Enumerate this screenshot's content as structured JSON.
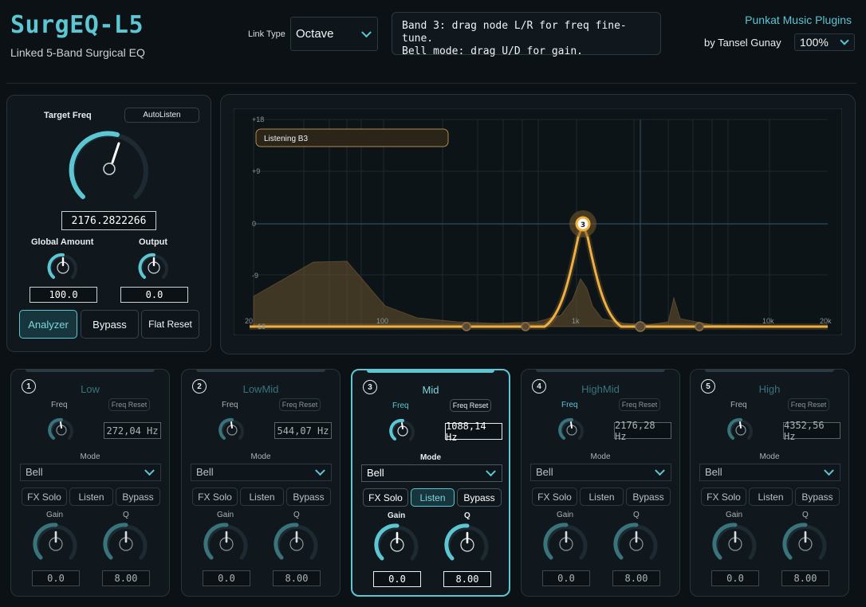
{
  "header": {
    "title": "SurgEQ-L5",
    "subtitle": "Linked 5-Band Surgical EQ",
    "link_type_label": "Link Type",
    "link_type_value": "Octave",
    "hint": "Band 3: drag node L/R for freq fine-tune.\nBell mode: drag U/D for gain.",
    "brand": "Punkat Music Plugins",
    "author": "by Tansel Gunay",
    "zoom": "100%"
  },
  "left": {
    "target_label": "Target Freq",
    "autolisten": "AutoListen",
    "target_value": "2176.2822266",
    "global_label": "Global Amount",
    "global_value": "100.0",
    "output_label": "Output",
    "output_value": "0.0",
    "analyzer": "Analyzer",
    "bypass": "Bypass",
    "flat_reset": "Flat Reset"
  },
  "graph": {
    "y_labels": [
      "+18",
      "+9",
      "0",
      "-9",
      "-18"
    ],
    "x_labels": [
      "20",
      "100",
      "1k",
      "10k",
      "20k"
    ],
    "listening": "Listening B3",
    "node_label": "3"
  },
  "band_common": {
    "freq_label": "Freq",
    "freq_reset": "Freq Reset",
    "mode_label": "Mode",
    "fx_solo": "FX Solo",
    "listen": "Listen",
    "bypass": "Bypass",
    "gain_label": "Gain",
    "q_label": "Q"
  },
  "bands": [
    {
      "num": "1",
      "name": "Low",
      "freq": "272,04 Hz",
      "mode": "Bell",
      "gain": "0.0",
      "q": "8.00"
    },
    {
      "num": "2",
      "name": "LowMid",
      "freq": "544,07 Hz",
      "mode": "Bell",
      "gain": "0.0",
      "q": "8.00"
    },
    {
      "num": "3",
      "name": "Mid",
      "freq": "1088,14 Hz",
      "mode": "Bell",
      "gain": "0.0",
      "q": "8.00"
    },
    {
      "num": "4",
      "name": "HighMid",
      "freq": "2176,28 Hz",
      "mode": "Bell",
      "gain": "0.0",
      "q": "8.00"
    },
    {
      "num": "5",
      "name": "High",
      "freq": "4352,56 Hz",
      "mode": "Bell",
      "gain": "0.0",
      "q": "8.00"
    }
  ],
  "colors": {
    "accent": "#5cc6d2",
    "curve": "#f0b040",
    "background": "#0b1115"
  }
}
